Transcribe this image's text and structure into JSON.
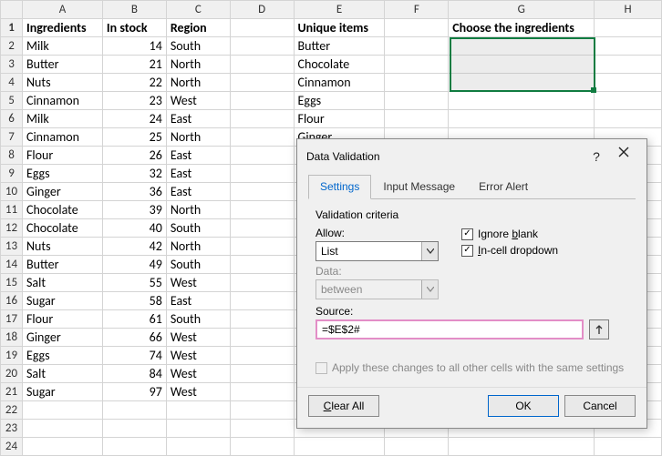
{
  "columns": [
    "A",
    "B",
    "C",
    "D",
    "E",
    "F",
    "G",
    "H"
  ],
  "headerRow": {
    "A": "Ingredients",
    "B": "In stock",
    "C": "Region",
    "E": "Unique items",
    "G": "Choose the ingredients"
  },
  "rows": [
    {
      "A": "Milk",
      "B": 14,
      "C": "South",
      "E": "Butter"
    },
    {
      "A": "Butter",
      "B": 21,
      "C": "North",
      "E": "Chocolate"
    },
    {
      "A": "Nuts",
      "B": 22,
      "C": "North",
      "E": "Cinnamon"
    },
    {
      "A": "Cinnamon",
      "B": 23,
      "C": "West",
      "E": "Eggs"
    },
    {
      "A": "Milk",
      "B": 24,
      "C": "East",
      "E": "Flour"
    },
    {
      "A": "Cinnamon",
      "B": 25,
      "C": "North",
      "E": "Ginger"
    },
    {
      "A": "Flour",
      "B": 26,
      "C": "East"
    },
    {
      "A": "Eggs",
      "B": 32,
      "C": "East"
    },
    {
      "A": "Ginger",
      "B": 36,
      "C": "East"
    },
    {
      "A": "Chocolate",
      "B": 39,
      "C": "North"
    },
    {
      "A": "Chocolate",
      "B": 40,
      "C": "South"
    },
    {
      "A": "Nuts",
      "B": 42,
      "C": "North"
    },
    {
      "A": "Butter",
      "B": 49,
      "C": "South"
    },
    {
      "A": "Salt",
      "B": 55,
      "C": "West"
    },
    {
      "A": "Sugar",
      "B": 58,
      "C": "East"
    },
    {
      "A": "Flour",
      "B": 61,
      "C": "South"
    },
    {
      "A": "Ginger",
      "B": 66,
      "C": "West"
    },
    {
      "A": "Eggs",
      "B": 74,
      "C": "West"
    },
    {
      "A": "Salt",
      "B": 84,
      "C": "West"
    },
    {
      "A": "Sugar",
      "B": 97,
      "C": "West"
    }
  ],
  "totalVisibleRows": 24,
  "dialog": {
    "title": "Data Validation",
    "tabs": [
      "Settings",
      "Input Message",
      "Error Alert"
    ],
    "activeTab": 0,
    "criteriaLabel": "Validation criteria",
    "allowLabel": "Allow:",
    "allowValue": "List",
    "dataLabel": "Data:",
    "dataValue": "between",
    "sourceLabel": "Source:",
    "sourceValue": "=$E$2#",
    "ignoreBlank": {
      "checked": true,
      "label_pre": "Ignore ",
      "accel": "b",
      "label_post": "lank"
    },
    "inCell": {
      "checked": true,
      "accel": "I",
      "label_post": "n-cell dropdown"
    },
    "applyAll": {
      "checked": false,
      "label": "Apply these changes to all other cells with the same settings"
    },
    "buttons": {
      "clear_pre": "",
      "clear_accel": "C",
      "clear_post": "lear All",
      "ok": "OK",
      "cancel": "Cancel"
    }
  }
}
